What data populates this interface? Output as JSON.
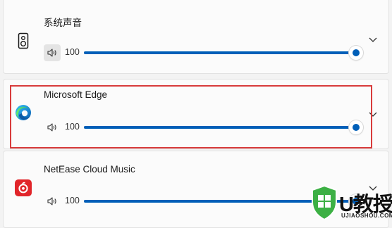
{
  "window": {
    "title": ""
  },
  "colors": {
    "accent": "#005fb8",
    "highlight": "#d83b3b",
    "card": "#fbfbfb"
  },
  "apps": [
    {
      "name": "系统声音",
      "icon": "speaker-device-icon",
      "volume_label": "100",
      "volume": 100,
      "expanded": false
    },
    {
      "name": "Microsoft Edge",
      "icon": "edge-browser-icon",
      "volume_label": "100",
      "volume": 100,
      "expanded": false
    },
    {
      "name": "NetEase Cloud Music",
      "icon": "netease-cloud-music-icon",
      "volume_label": "100",
      "volume": 100,
      "expanded": false
    }
  ],
  "watermark": {
    "brand": "U教授",
    "url": "UJIAOSHOU.COM"
  }
}
